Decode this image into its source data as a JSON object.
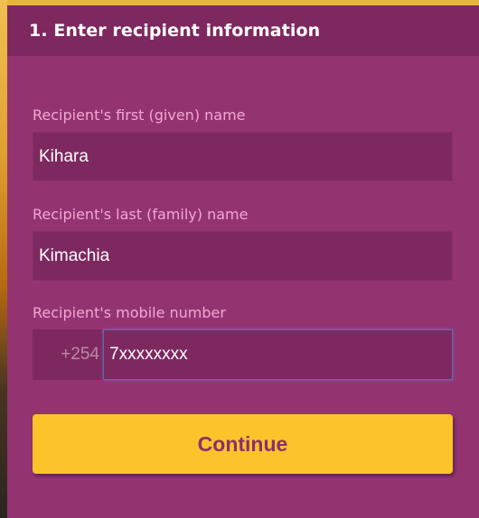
{
  "section": {
    "title": "1. Enter recipient information"
  },
  "fields": {
    "first_name": {
      "label": "Recipient's first (given) name",
      "value": "Kihara"
    },
    "last_name": {
      "label": "Recipient's last (family) name",
      "value": "Kimachia"
    },
    "mobile": {
      "label": "Recipient's mobile number",
      "prefix": "+254",
      "value": "7xxxxxxxx"
    }
  },
  "actions": {
    "continue_label": "Continue"
  },
  "colors": {
    "panel": "#933471",
    "header": "#7e2860",
    "label": "#f3a6d4",
    "button": "#fbc42a",
    "button_text": "#8c2f6c"
  }
}
